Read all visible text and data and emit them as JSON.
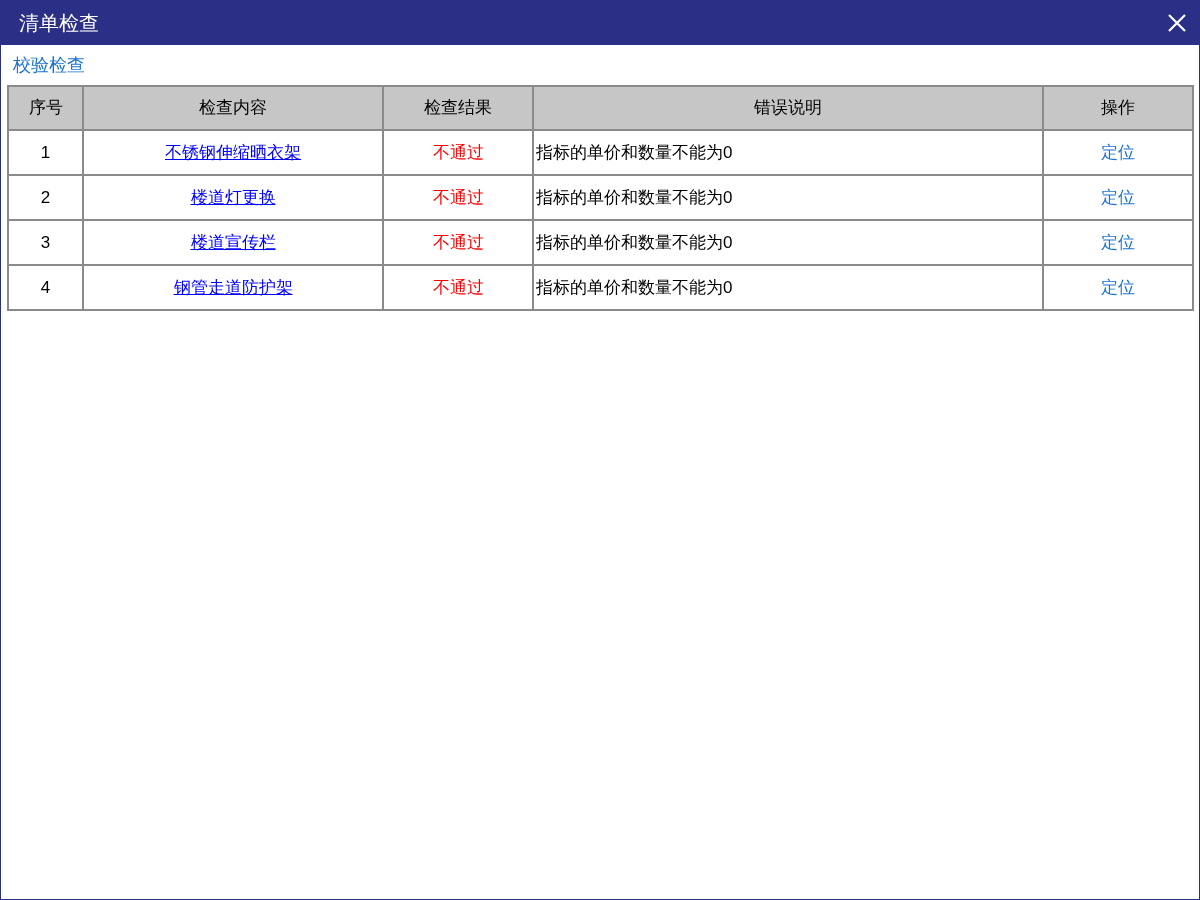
{
  "window": {
    "title": "清单检查"
  },
  "toolbar_link": "校验检查",
  "table": {
    "columns": [
      "序号",
      "检查内容",
      "检查结果",
      "错误说明",
      "操作"
    ],
    "rows": [
      {
        "index": "1",
        "item": "不锈钢伸缩晒衣架",
        "result": "不通过",
        "passed": false,
        "error": "指标的单价和数量不能为0",
        "action": "定位"
      },
      {
        "index": "2",
        "item": "楼道灯更换",
        "result": "不通过",
        "passed": false,
        "error": "指标的单价和数量不能为0",
        "action": "定位"
      },
      {
        "index": "3",
        "item": "楼道宣传栏",
        "result": "不通过",
        "passed": false,
        "error": "指标的单价和数量不能为0",
        "action": "定位"
      },
      {
        "index": "4",
        "item": "钢管走道防护架",
        "result": "不通过",
        "passed": false,
        "error": "指标的单价和数量不能为0",
        "action": "定位"
      }
    ]
  }
}
